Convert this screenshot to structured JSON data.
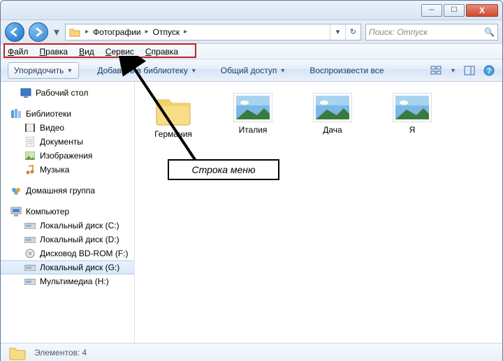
{
  "window": {
    "minimize": "─",
    "maximize": "☐",
    "close": "X"
  },
  "nav": {
    "crumbs": [
      "Фотографии",
      "Отпуск"
    ],
    "refresh": "↻",
    "dropdown": "▾"
  },
  "search": {
    "placeholder": "Поиск: Отпуск",
    "icon": "🔍"
  },
  "menubar": [
    "Файл",
    "Правка",
    "Вид",
    "Сервис",
    "Справка"
  ],
  "toolbar": {
    "organize": "Упорядочить",
    "addlib": "Добавить в библиотеку",
    "share": "Общий доступ",
    "play": "Воспроизвести все"
  },
  "sidebar": {
    "desktop": "Рабочий стол",
    "libraries": "Библиотеки",
    "lib_items": [
      "Видео",
      "Документы",
      "Изображения",
      "Музыка"
    ],
    "homegroup": "Домашняя группа",
    "computer": "Компьютер",
    "drives": [
      "Локальный диск (C:)",
      "Локальный диск (D:)",
      "Дисковод BD-ROM (F:)",
      "Локальный диск (G:)",
      "Мультимедиа (H:)"
    ]
  },
  "items": [
    {
      "name": "Германия",
      "type": "folder"
    },
    {
      "name": "Италия",
      "type": "photo"
    },
    {
      "name": "Дача",
      "type": "photo"
    },
    {
      "name": "Я",
      "type": "photo"
    }
  ],
  "statusbar": {
    "label": "Элементов: 4"
  },
  "annotation": {
    "label": "Строка меню"
  }
}
